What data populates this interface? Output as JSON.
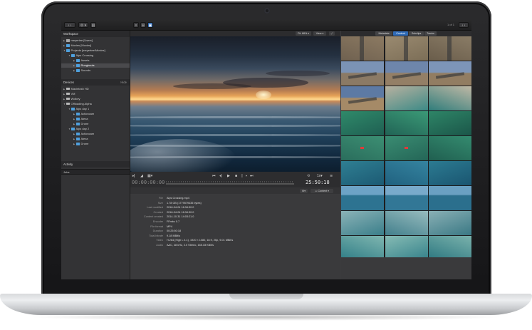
{
  "window": {
    "page_indicator": "1 of 1",
    "view_buttons": [
      "≡",
      "⊞",
      "▣"
    ]
  },
  "sidebar": {
    "workspace_title": "Workspace",
    "workspace_items": [
      {
        "label": "meyertee [Users]",
        "indent": 0,
        "icon": "home",
        "expanded": false
      },
      {
        "label": "Movies [Movies]",
        "indent": 0,
        "icon": "folder",
        "expanded": false
      },
      {
        "label": "Projects [meyertee/Movies]",
        "indent": 0,
        "icon": "folder",
        "expanded": true
      },
      {
        "label": "Alps Crossing",
        "indent": 1,
        "icon": "folder",
        "expanded": true
      },
      {
        "label": "Assets",
        "indent": 2,
        "icon": "folder",
        "expanded": false
      },
      {
        "label": "Roughcuts",
        "indent": 2,
        "icon": "folder",
        "expanded": false,
        "selected": true
      },
      {
        "label": "Sounds",
        "indent": 2,
        "icon": "folder",
        "expanded": false
      }
    ],
    "devices_title": "Devices",
    "devices_action": "Hide",
    "device_items": [
      {
        "label": "Macintosh HD",
        "indent": 0,
        "icon": "disk"
      },
      {
        "label": "VM",
        "indent": 0,
        "icon": "disk"
      },
      {
        "label": "Wolkey",
        "indent": 0,
        "icon": "disk"
      },
      {
        "label": "Offloading Alpha",
        "indent": 0,
        "icon": "disk",
        "expanded": true
      },
      {
        "label": "Alps day 1",
        "indent": 1,
        "icon": "folder",
        "expanded": true
      },
      {
        "label": "Actioncam",
        "indent": 2,
        "icon": "folder"
      },
      {
        "label": "Alexa",
        "indent": 2,
        "icon": "folder"
      },
      {
        "label": "Drone",
        "indent": 2,
        "icon": "folder"
      },
      {
        "label": "Alps day 2",
        "indent": 1,
        "icon": "folder",
        "expanded": true
      },
      {
        "label": "Actioncam",
        "indent": 2,
        "icon": "folder"
      },
      {
        "label": "Alexa",
        "indent": 2,
        "icon": "folder"
      },
      {
        "label": "Drone",
        "indent": 2,
        "icon": "folder"
      }
    ],
    "activity_title": "Activity",
    "activity_input": "Jobs"
  },
  "viewer": {
    "fit_label": "Fit: 68%",
    "view_label": "View",
    "timecode_start": "00:00:00:00",
    "timecode_end": "25:50:18",
    "speed_label": "1x",
    "progress": 0.0
  },
  "metadata": {
    "dropdown_label": "Content",
    "rows": [
      {
        "key": "File",
        "value": "Alps Crossing.mp4"
      },
      {
        "key": "Size",
        "value": "1.78 GB (1779579435 bytes)"
      },
      {
        "key": "Last modified",
        "value": "2016-04-04 16:34:30.0"
      },
      {
        "key": "Created",
        "value": "2016-04-04 16:34:30.0"
      },
      {
        "key": "Content created",
        "value": "2014-10-31 14:03:21.0"
      },
      {
        "key": "Encoder",
        "value": "FFmbc 0.7"
      },
      {
        "key": "File format",
        "value": "MP4"
      },
      {
        "key": "Duration",
        "value": "00:25:50:18"
      },
      {
        "key": "Total bitrate",
        "value": "9.18 MBit/s"
      },
      {
        "key": "Video",
        "value": "H.264 (High L 4.1), 1920 × 1080, 16:9, 25p, 9.01 MBit/s"
      },
      {
        "key": "Audio",
        "value": "AAC, 48 kHz, 2.0 Stereo, 165.33 KBit/s"
      }
    ]
  },
  "browser": {
    "tabs": [
      "Metadata",
      "Content",
      "Subclips",
      "Tracks"
    ],
    "active_tab": "Content",
    "thumbnails": [
      {
        "kind": "road-desert",
        "colors": [
          "#8c7a62",
          "#6f6150"
        ]
      },
      {
        "kind": "road-desert",
        "colors": [
          "#9a8a70",
          "#7c6e57"
        ]
      },
      {
        "kind": "road-desert",
        "colors": [
          "#8a7c66",
          "#6a5d4b"
        ]
      },
      {
        "kind": "road-sky",
        "colors": [
          "#7b93b5",
          "#8b7a65"
        ]
      },
      {
        "kind": "road-sky",
        "colors": [
          "#6e86ab",
          "#947f66"
        ]
      },
      {
        "kind": "road-sky",
        "colors": [
          "#7d95b8",
          "#927d62"
        ]
      },
      {
        "kind": "road-sky",
        "colors": [
          "#5d7aa4",
          "#a58a67"
        ]
      },
      {
        "kind": "coast",
        "colors": [
          "#b8b1a0",
          "#3c8a86"
        ]
      },
      {
        "kind": "coast",
        "colors": [
          "#c0b8a5",
          "#2f7d7b"
        ]
      },
      {
        "kind": "reef",
        "colors": [
          "#2f8a6a",
          "#1f5f52"
        ]
      },
      {
        "kind": "reef",
        "colors": [
          "#3b9a77",
          "#216355"
        ]
      },
      {
        "kind": "reef",
        "colors": [
          "#2e8567",
          "#1b5649"
        ]
      },
      {
        "kind": "reef-car",
        "colors": [
          "#3c8f73",
          "#2a6d5c"
        ]
      },
      {
        "kind": "reef-car",
        "colors": [
          "#3a8c72",
          "#246657"
        ]
      },
      {
        "kind": "reef",
        "colors": [
          "#348b6f",
          "#205f50"
        ]
      },
      {
        "kind": "water",
        "colors": [
          "#2f7f93",
          "#1c5a73"
        ]
      },
      {
        "kind": "water",
        "colors": [
          "#3584a0",
          "#20617f"
        ]
      },
      {
        "kind": "water",
        "colors": [
          "#2c7b92",
          "#1a5570"
        ]
      },
      {
        "kind": "horizon",
        "colors": [
          "#6da3c6",
          "#2d7391"
        ]
      },
      {
        "kind": "horizon",
        "colors": [
          "#79aacb",
          "#327796"
        ]
      },
      {
        "kind": "horizon",
        "colors": [
          "#6aa0c2",
          "#2b6f8d"
        ]
      },
      {
        "kind": "shore",
        "colors": [
          "#8bb3b7",
          "#3a7e8a"
        ]
      },
      {
        "kind": "shore",
        "colors": [
          "#97bcbe",
          "#427f8c"
        ]
      },
      {
        "kind": "shore",
        "colors": [
          "#89b0b5",
          "#3a7884"
        ]
      },
      {
        "kind": "lagoon",
        "colors": [
          "#7fb6b0",
          "#2f7d86"
        ]
      },
      {
        "kind": "lagoon",
        "colors": [
          "#86bbb4",
          "#34818a"
        ]
      },
      {
        "kind": "lagoon",
        "colors": [
          "#7ab2ac",
          "#2c7780"
        ]
      },
      {
        "kind": "beach",
        "colors": [
          "#a8c6bb",
          "#2f7480"
        ]
      },
      {
        "kind": "beach",
        "colors": [
          "#b0cabf",
          "#377a85"
        ]
      },
      {
        "kind": "beach",
        "colors": [
          "#a2c0b6",
          "#2d6f7a"
        ]
      }
    ]
  },
  "colors": {
    "accent": "#2f6bb7",
    "folder": "#4fa0dd"
  }
}
